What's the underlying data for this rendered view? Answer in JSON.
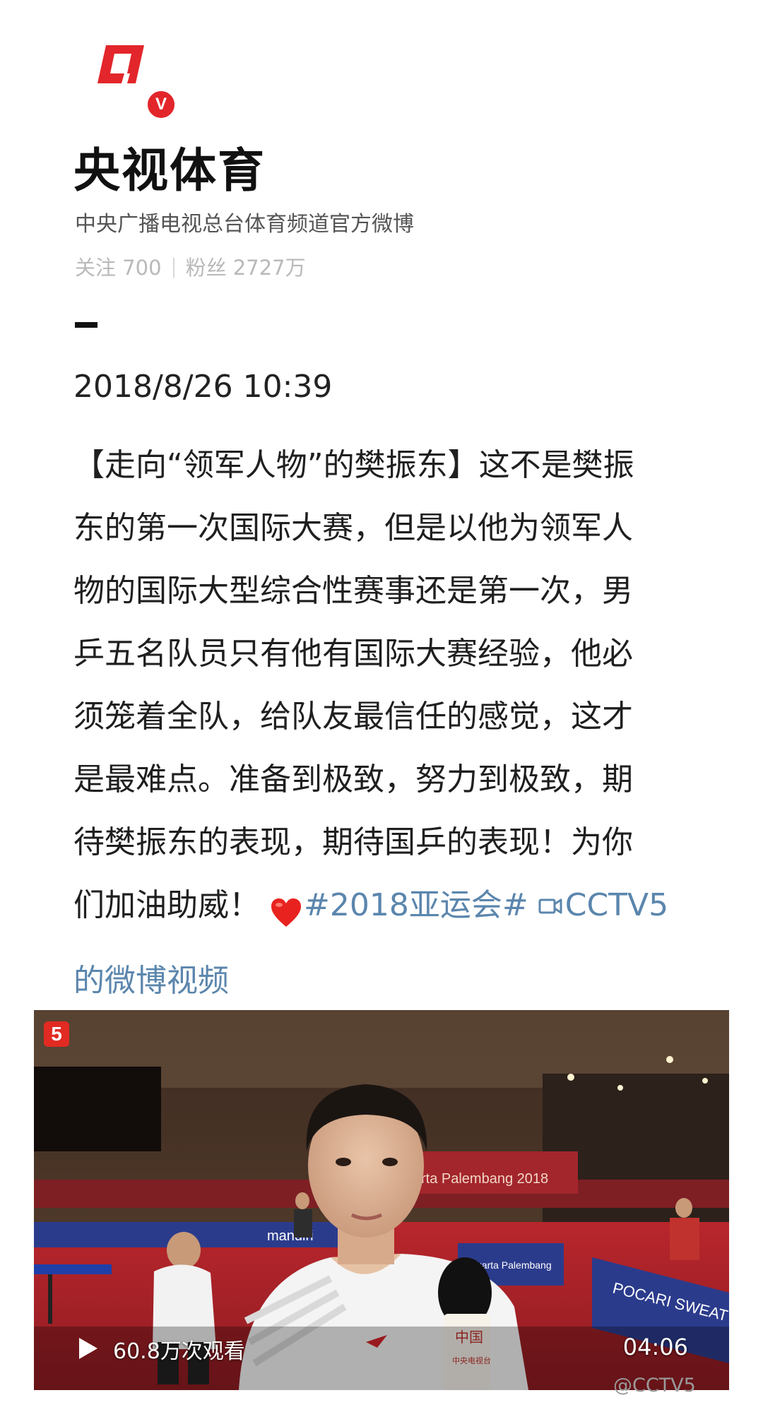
{
  "profile": {
    "logo_icon": "cctv5-red-logo-icon",
    "verified_icon": "verified-v-icon",
    "verified_mark": "V",
    "name": "央视体育",
    "description": "中央广播电视总台体育频道官方微博",
    "following_label": "关注 700",
    "followers_label": "粉丝 2727万"
  },
  "post": {
    "timestamp": "2018/8/26 10:39",
    "lines": [
      "【走向“领军人物”的樊振东】这不是樊振",
      "东的第一次国际大赛，但是以他为领军人",
      "物的国际大型综合性赛事还是第一次，男",
      "乒五名队员只有他有国际大赛经验，他必",
      "须笼着全队，给队友最信任的感觉，这才",
      "是最难点。准备到极致，努力到极致，期",
      "待樊振东的表现，期待国乒的表现！为你"
    ],
    "last_line_text": "们加油助威！",
    "heart_icon": "red-heart-emoji-icon",
    "hashtag": "#2018亚运会#",
    "video_link_icon": "video-camera-icon",
    "video_link_part1": "CCTV5",
    "video_link_part2": "的微博视频"
  },
  "video": {
    "channel_badge": "5",
    "play_icon": "play-icon",
    "views": "60.8万次观看",
    "duration": "04:06",
    "banner_text": "rta Palembang 2018",
    "board1": "mandiri",
    "board2": "POCARI SWEAT",
    "board3": "Jakarta Palembang",
    "mic_text": "中国",
    "mic_sub": "中央电视台"
  },
  "watermark": "@CCTV5",
  "colors": {
    "brand_red": "#e2262b",
    "link_blue": "#5b86ad",
    "muted_gray": "#b9b9b9"
  }
}
